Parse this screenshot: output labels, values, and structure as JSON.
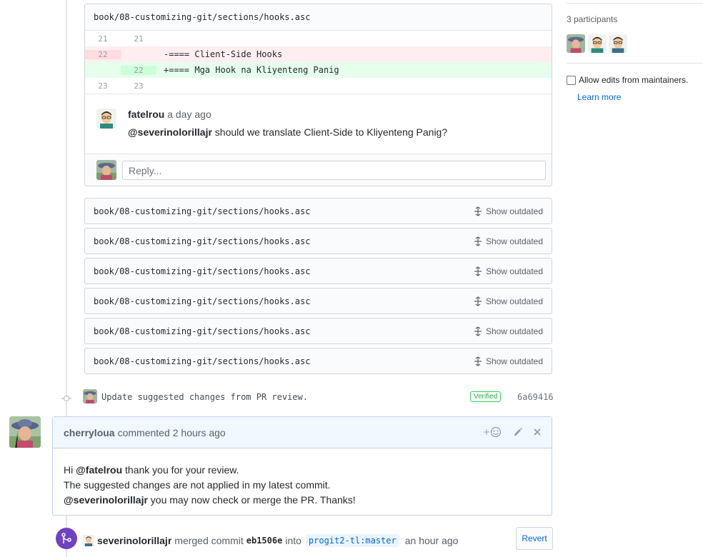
{
  "diff": {
    "filename": "book/08-customizing-git/sections/hooks.asc",
    "rows": [
      {
        "old": "21",
        "new": "21",
        "code": ""
      },
      {
        "old": "22",
        "new": "",
        "code": "-==== Client-Side Hooks"
      },
      {
        "old": "",
        "new": "22",
        "code": "+==== Mga Hook na Kliyenteng Panig"
      },
      {
        "old": "23",
        "new": "23",
        "code": ""
      }
    ],
    "comment": {
      "author": "fatelrou",
      "time": "a day ago",
      "mention": "@severinolorillajr",
      "text": " should we translate Client-Side to Kliyenteng Panig?"
    },
    "reply_placeholder": "Reply..."
  },
  "outdated_files": [
    {
      "filename": "book/08-customizing-git/sections/hooks.asc",
      "action": "Show outdated"
    },
    {
      "filename": "book/08-customizing-git/sections/hooks.asc",
      "action": "Show outdated"
    },
    {
      "filename": "book/08-customizing-git/sections/hooks.asc",
      "action": "Show outdated"
    },
    {
      "filename": "book/08-customizing-git/sections/hooks.asc",
      "action": "Show outdated"
    },
    {
      "filename": "book/08-customizing-git/sections/hooks.asc",
      "action": "Show outdated"
    },
    {
      "filename": "book/08-customizing-git/sections/hooks.asc",
      "action": "Show outdated"
    }
  ],
  "commit": {
    "message": "Update suggested changes from PR review.",
    "badge": "Verified",
    "sha": "6a69416"
  },
  "main_comment": {
    "author": "cherryloua",
    "action": "commented",
    "time": "2 hours ago",
    "line1_prefix": "Hi ",
    "line1_mention": "@fatelrou",
    "line1_suffix": " thank you for your review.",
    "line2": "The suggested changes are not applied in my latest commit.",
    "line3_mention": "@severinolorillajr",
    "line3_suffix": " you may now check or merge the PR. Thanks!"
  },
  "merge": {
    "user": "severinolorillajr",
    "text1": "merged commit",
    "sha": "eb1506e",
    "text2": "into",
    "branch": "progit2-tl:master",
    "time": "an hour ago",
    "revert_label": "Revert"
  },
  "sidebar": {
    "participants_label": "3 participants",
    "allow_edits_label": "Allow edits from maintainers.",
    "learn_more": "Learn more"
  },
  "colors": {
    "accent": "#0366d6",
    "merged": "#6f42c1",
    "verified": "#28a745",
    "deletion_bg": "#ffeef0",
    "addition_bg": "#e6ffed"
  }
}
